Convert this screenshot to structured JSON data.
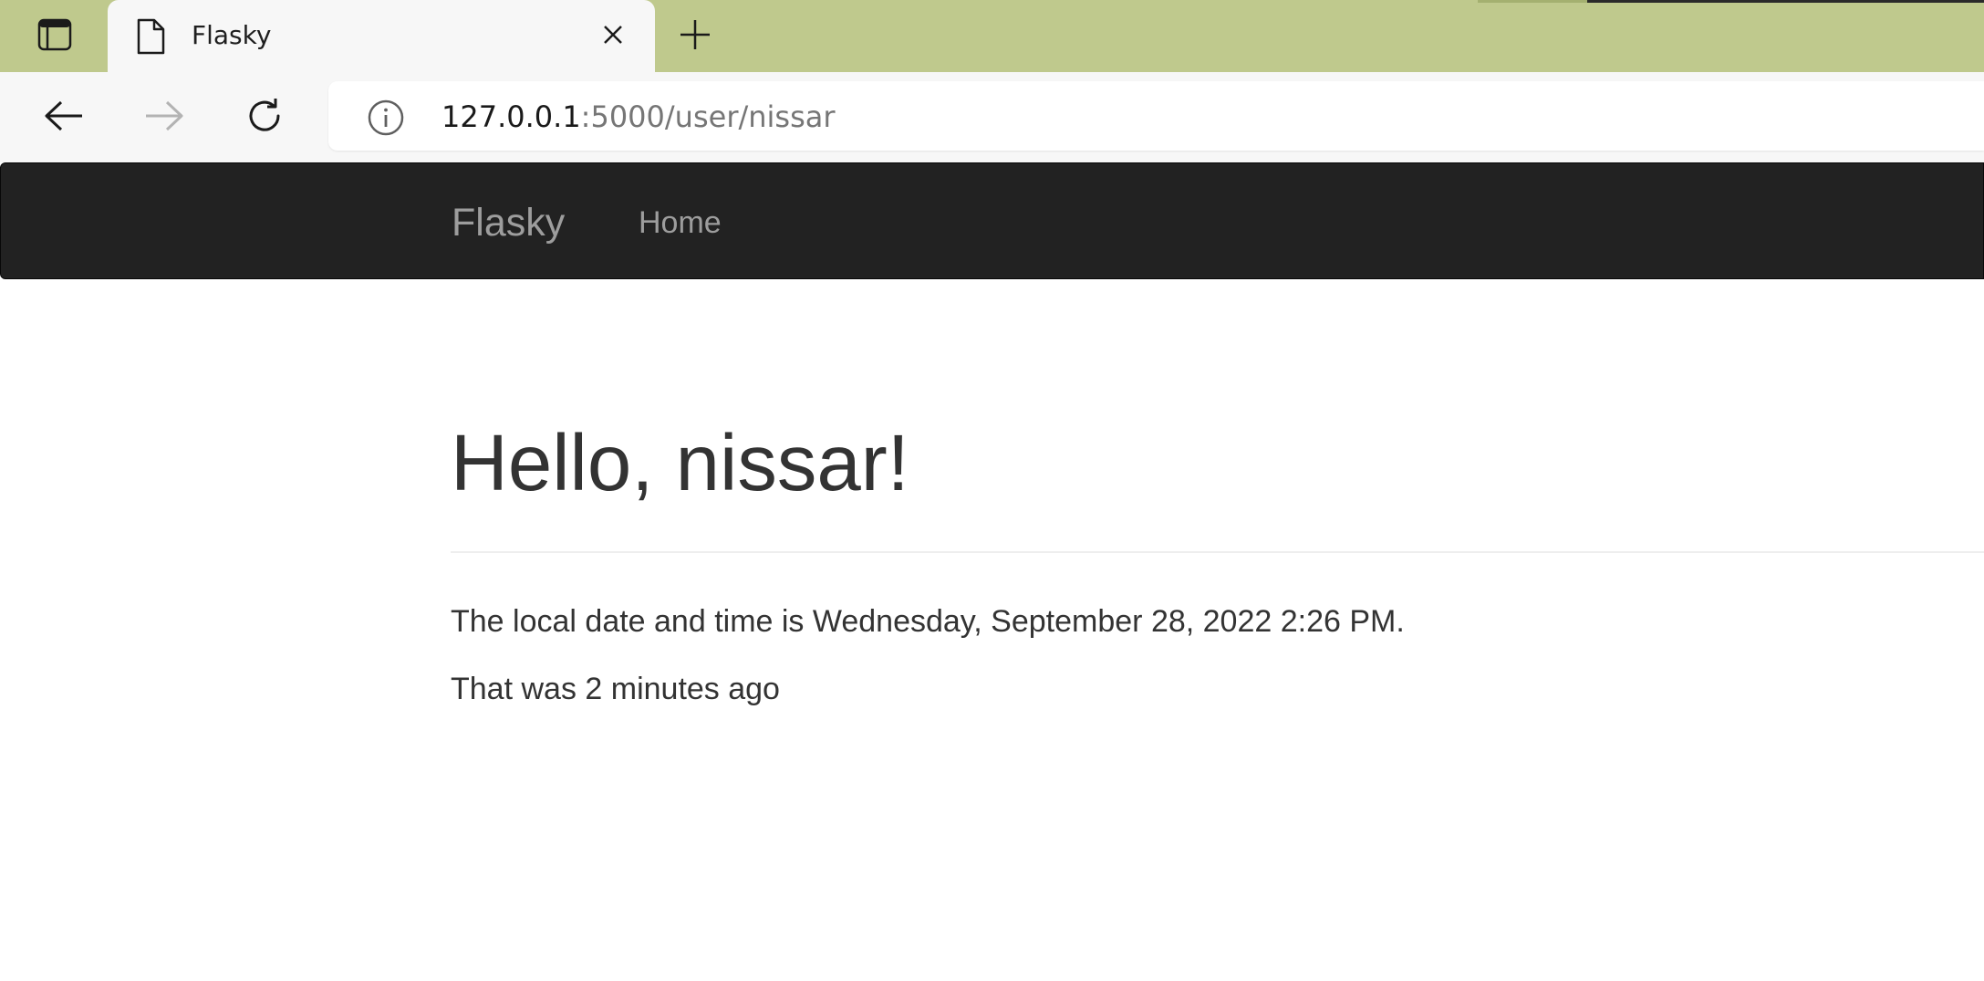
{
  "browser": {
    "tab": {
      "title": "Flasky",
      "icon": "document-icon"
    },
    "address": {
      "host": "127.0.0.1",
      "rest": ":5000/user/nissar"
    },
    "colors": {
      "tabstrip": "#bfc98d",
      "toolbar": "#f7f7f7"
    }
  },
  "site": {
    "navbar": {
      "brand": "Flasky",
      "links": [
        {
          "label": "Home"
        }
      ],
      "background": "#222222"
    },
    "page": {
      "heading": "Hello, nissar!",
      "local_time_text": "The local date and time is Wednesday, September 28, 2022 2:26 PM.",
      "relative_time_text": "That was 2 minutes ago"
    }
  }
}
